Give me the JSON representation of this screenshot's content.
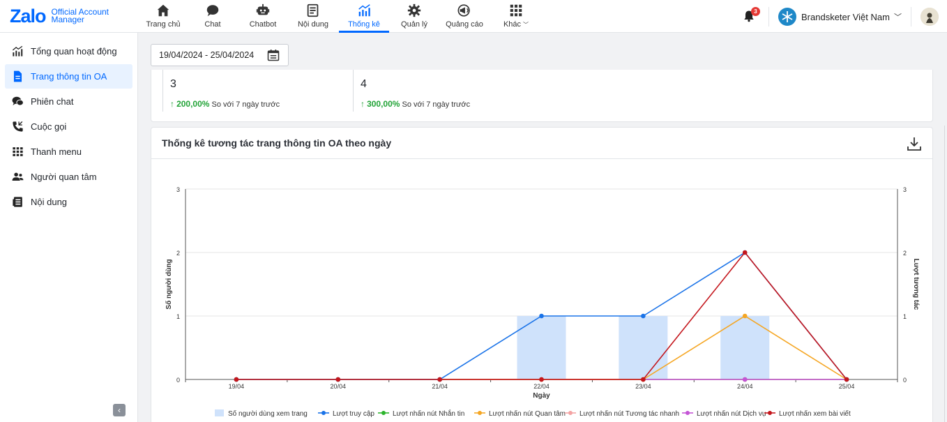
{
  "logo": {
    "brand": "Zalo",
    "line1": "Official Account",
    "line2": "Manager"
  },
  "nav": [
    {
      "label": "Trang chủ",
      "icon": "home-icon"
    },
    {
      "label": "Chat",
      "icon": "chat-icon"
    },
    {
      "label": "Chatbot",
      "icon": "robot-icon"
    },
    {
      "label": "Nội dung",
      "icon": "content-icon"
    },
    {
      "label": "Thống kê",
      "icon": "stats-icon",
      "active": true
    },
    {
      "label": "Quản lý",
      "icon": "gear-icon"
    },
    {
      "label": "Quảng cáo",
      "icon": "megaphone-icon"
    },
    {
      "label": "Khác",
      "icon": "grid-icon"
    }
  ],
  "header": {
    "notification_count": "3",
    "account_name": "Brandsketer Việt Nam"
  },
  "sidebar": {
    "items": [
      {
        "label": "Tổng quan hoạt động",
        "icon": "bar-chart-icon"
      },
      {
        "label": "Trang thông tin OA",
        "icon": "document-icon",
        "active": true
      },
      {
        "label": "Phiên chat",
        "icon": "chat-bubbles-icon"
      },
      {
        "label": "Cuộc gọi",
        "icon": "phone-icon"
      },
      {
        "label": "Thanh menu",
        "icon": "grid-icon"
      },
      {
        "label": "Người quan tâm",
        "icon": "users-icon"
      },
      {
        "label": "Nội dung",
        "icon": "news-icon"
      }
    ]
  },
  "filter": {
    "date_range": "19/04/2024 - 25/04/2024"
  },
  "stats": [
    {
      "value": "3",
      "change": "200,00%",
      "compare": "So với 7 ngày trước"
    },
    {
      "value": "4",
      "change": "300,00%",
      "compare": "So với 7 ngày trước"
    }
  ],
  "chart_card": {
    "title": "Thống kê tương tác trang thông tin OA theo ngày"
  },
  "chart_data": {
    "type": "bar",
    "categories": [
      "19/04",
      "20/04",
      "21/04",
      "22/04",
      "23/04",
      "24/04",
      "25/04"
    ],
    "xlabel": "Ngày",
    "ylabel": "Số người dùng",
    "y2label": "Lượt tương tác",
    "ylim": [
      0,
      3
    ],
    "y2lim": [
      0,
      3
    ],
    "yticks": [
      0,
      1,
      2,
      3
    ],
    "grid": true,
    "legend_position": "bottom",
    "series": [
      {
        "name": "Số người dùng xem trang",
        "kind": "bar",
        "color": "#cfe2fb",
        "values": [
          0,
          0,
          0,
          1,
          1,
          1,
          0
        ]
      },
      {
        "name": "Lượt truy cập",
        "kind": "line",
        "color": "#1a73e8",
        "values": [
          0,
          0,
          0,
          1,
          1,
          2,
          0
        ]
      },
      {
        "name": "Lượt nhấn nút Nhắn tin",
        "kind": "line",
        "color": "#2cb52c",
        "values": [
          0,
          0,
          0,
          0,
          0,
          0,
          0
        ]
      },
      {
        "name": "Lượt nhấn nút Quan tâm",
        "kind": "line",
        "color": "#f5a623",
        "values": [
          0,
          0,
          0,
          0,
          0,
          1,
          0
        ]
      },
      {
        "name": "Lượt nhấn nút Tương tác nhanh",
        "kind": "line",
        "color": "#f4a3a3",
        "values": [
          0,
          0,
          0,
          0,
          0,
          0,
          0
        ]
      },
      {
        "name": "Lượt nhấn nút Dịch vụ",
        "kind": "line",
        "color": "#c455d6",
        "values": [
          0,
          0,
          0,
          0,
          0,
          0,
          0
        ]
      },
      {
        "name": "Lượt nhấn xem bài viết",
        "kind": "line",
        "color": "#c4161c",
        "values": [
          0,
          0,
          0,
          0,
          0,
          2,
          0
        ]
      }
    ]
  }
}
